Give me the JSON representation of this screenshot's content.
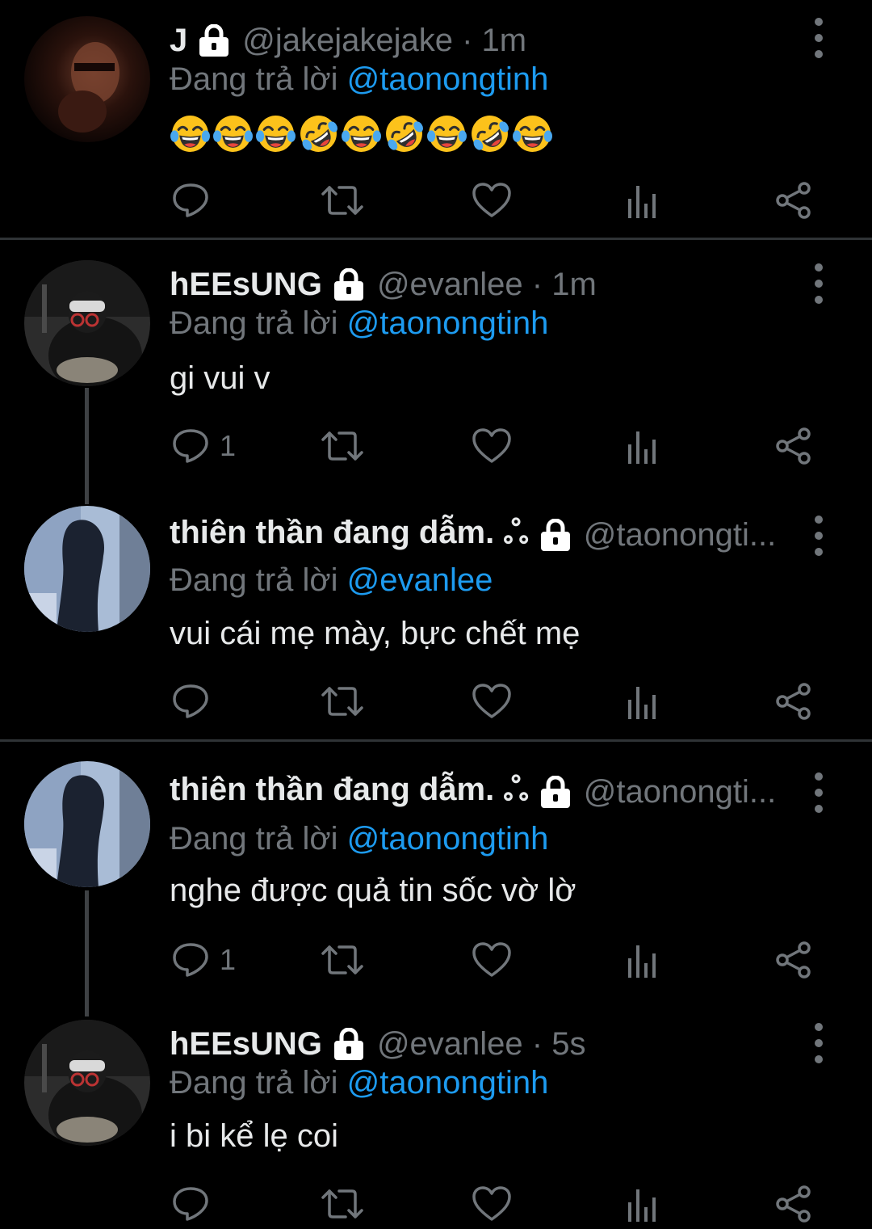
{
  "colors": {
    "background": "#000000",
    "text": "#e7e9ea",
    "muted": "#71767b",
    "accent": "#1d9bf0",
    "divider": "#2f3336"
  },
  "icons": {
    "reply": "speech-bubble-icon",
    "retweet": "retweet-arrows-icon",
    "like": "heart-icon",
    "views": "bar-chart-icon",
    "share": "share-nodes-icon",
    "protected": "lock-icon",
    "more": "vertical-ellipsis-icon"
  },
  "tweets": [
    {
      "name": "J",
      "handle_time": "@jakejakejake · 1m",
      "replying_prefix": "Đang trả lời",
      "replying_to": "@taonongtinh",
      "text": "",
      "emojis": [
        "tears-of-joy",
        "tears-of-joy",
        "tears-of-joy",
        "rolling-on-floor-laughing",
        "tears-of-joy",
        "rolling-on-floor-laughing",
        "tears-of-joy",
        "rolling-on-floor-laughing",
        "tears-of-joy"
      ],
      "reply_count": ""
    },
    {
      "name": "hEEsUNG",
      "handle_time": "@evanlee · 1m",
      "replying_prefix": "Đang trả lời",
      "replying_to": "@taonongtinh",
      "text": "gi vui v",
      "reply_count": "1"
    },
    {
      "name": "thiên thần đang dẫm. ஃ",
      "handle_time": "@taonongti...",
      "replying_prefix": "Đang trả lời",
      "replying_to": "@evanlee",
      "text": "vui cái mẹ mày, bực chết mẹ",
      "reply_count": ""
    },
    {
      "name": "thiên thần đang dẫm. ஃ",
      "handle_time": "@taonongti...",
      "replying_prefix": "Đang trả lời",
      "replying_to": "@taonongtinh",
      "text": "nghe được quả tin sốc vờ lờ",
      "reply_count": "1"
    },
    {
      "name": "hEEsUNG",
      "handle_time": "@evanlee · 5s",
      "replying_prefix": "Đang trả lời",
      "replying_to": "@taonongtinh",
      "text": "i bi kể lẹ coi",
      "reply_count": ""
    }
  ]
}
